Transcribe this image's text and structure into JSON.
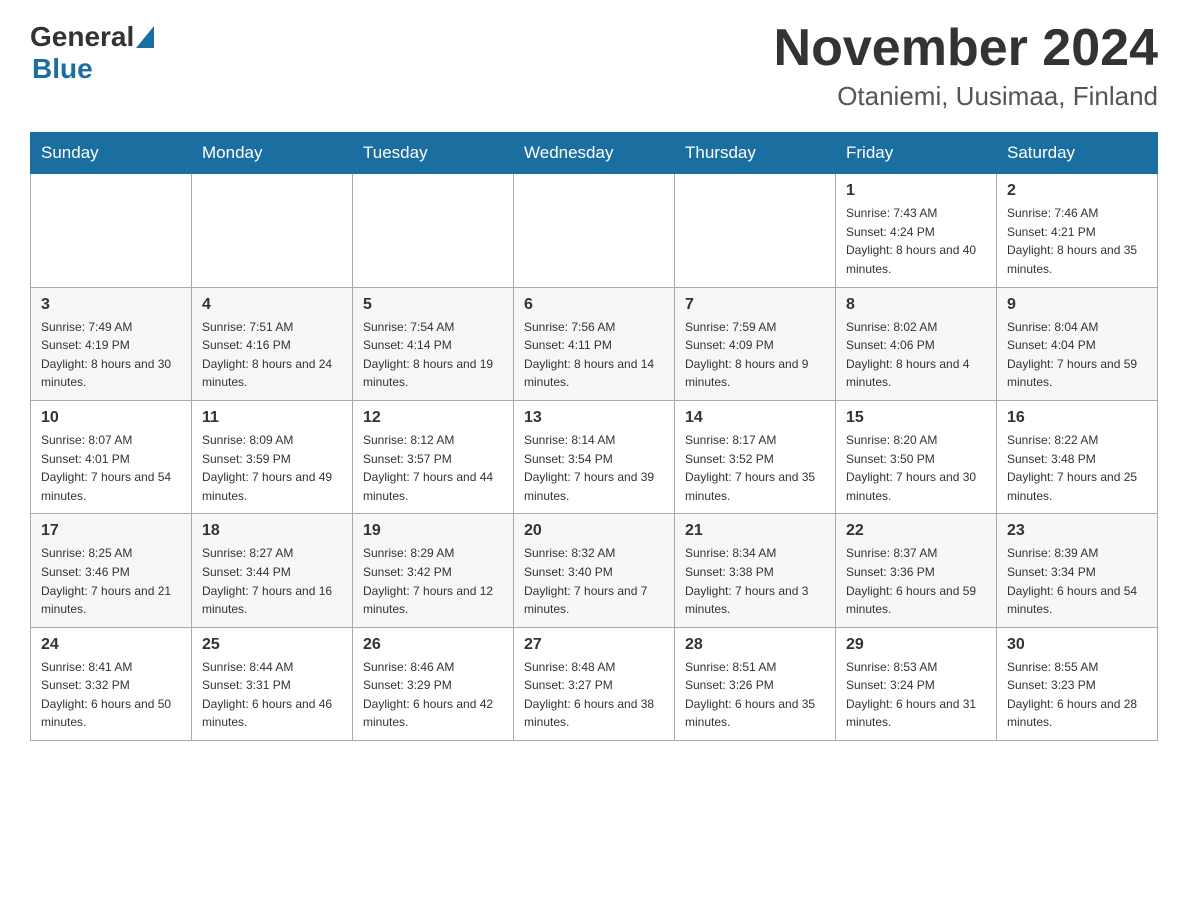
{
  "header": {
    "logo_general": "General",
    "logo_blue": "Blue",
    "month_title": "November 2024",
    "location": "Otaniemi, Uusimaa, Finland"
  },
  "days_of_week": [
    "Sunday",
    "Monday",
    "Tuesday",
    "Wednesday",
    "Thursday",
    "Friday",
    "Saturday"
  ],
  "weeks": [
    [
      {
        "day": "",
        "sunrise": "",
        "sunset": "",
        "daylight": ""
      },
      {
        "day": "",
        "sunrise": "",
        "sunset": "",
        "daylight": ""
      },
      {
        "day": "",
        "sunrise": "",
        "sunset": "",
        "daylight": ""
      },
      {
        "day": "",
        "sunrise": "",
        "sunset": "",
        "daylight": ""
      },
      {
        "day": "",
        "sunrise": "",
        "sunset": "",
        "daylight": ""
      },
      {
        "day": "1",
        "sunrise": "Sunrise: 7:43 AM",
        "sunset": "Sunset: 4:24 PM",
        "daylight": "Daylight: 8 hours and 40 minutes."
      },
      {
        "day": "2",
        "sunrise": "Sunrise: 7:46 AM",
        "sunset": "Sunset: 4:21 PM",
        "daylight": "Daylight: 8 hours and 35 minutes."
      }
    ],
    [
      {
        "day": "3",
        "sunrise": "Sunrise: 7:49 AM",
        "sunset": "Sunset: 4:19 PM",
        "daylight": "Daylight: 8 hours and 30 minutes."
      },
      {
        "day": "4",
        "sunrise": "Sunrise: 7:51 AM",
        "sunset": "Sunset: 4:16 PM",
        "daylight": "Daylight: 8 hours and 24 minutes."
      },
      {
        "day": "5",
        "sunrise": "Sunrise: 7:54 AM",
        "sunset": "Sunset: 4:14 PM",
        "daylight": "Daylight: 8 hours and 19 minutes."
      },
      {
        "day": "6",
        "sunrise": "Sunrise: 7:56 AM",
        "sunset": "Sunset: 4:11 PM",
        "daylight": "Daylight: 8 hours and 14 minutes."
      },
      {
        "day": "7",
        "sunrise": "Sunrise: 7:59 AM",
        "sunset": "Sunset: 4:09 PM",
        "daylight": "Daylight: 8 hours and 9 minutes."
      },
      {
        "day": "8",
        "sunrise": "Sunrise: 8:02 AM",
        "sunset": "Sunset: 4:06 PM",
        "daylight": "Daylight: 8 hours and 4 minutes."
      },
      {
        "day": "9",
        "sunrise": "Sunrise: 8:04 AM",
        "sunset": "Sunset: 4:04 PM",
        "daylight": "Daylight: 7 hours and 59 minutes."
      }
    ],
    [
      {
        "day": "10",
        "sunrise": "Sunrise: 8:07 AM",
        "sunset": "Sunset: 4:01 PM",
        "daylight": "Daylight: 7 hours and 54 minutes."
      },
      {
        "day": "11",
        "sunrise": "Sunrise: 8:09 AM",
        "sunset": "Sunset: 3:59 PM",
        "daylight": "Daylight: 7 hours and 49 minutes."
      },
      {
        "day": "12",
        "sunrise": "Sunrise: 8:12 AM",
        "sunset": "Sunset: 3:57 PM",
        "daylight": "Daylight: 7 hours and 44 minutes."
      },
      {
        "day": "13",
        "sunrise": "Sunrise: 8:14 AM",
        "sunset": "Sunset: 3:54 PM",
        "daylight": "Daylight: 7 hours and 39 minutes."
      },
      {
        "day": "14",
        "sunrise": "Sunrise: 8:17 AM",
        "sunset": "Sunset: 3:52 PM",
        "daylight": "Daylight: 7 hours and 35 minutes."
      },
      {
        "day": "15",
        "sunrise": "Sunrise: 8:20 AM",
        "sunset": "Sunset: 3:50 PM",
        "daylight": "Daylight: 7 hours and 30 minutes."
      },
      {
        "day": "16",
        "sunrise": "Sunrise: 8:22 AM",
        "sunset": "Sunset: 3:48 PM",
        "daylight": "Daylight: 7 hours and 25 minutes."
      }
    ],
    [
      {
        "day": "17",
        "sunrise": "Sunrise: 8:25 AM",
        "sunset": "Sunset: 3:46 PM",
        "daylight": "Daylight: 7 hours and 21 minutes."
      },
      {
        "day": "18",
        "sunrise": "Sunrise: 8:27 AM",
        "sunset": "Sunset: 3:44 PM",
        "daylight": "Daylight: 7 hours and 16 minutes."
      },
      {
        "day": "19",
        "sunrise": "Sunrise: 8:29 AM",
        "sunset": "Sunset: 3:42 PM",
        "daylight": "Daylight: 7 hours and 12 minutes."
      },
      {
        "day": "20",
        "sunrise": "Sunrise: 8:32 AM",
        "sunset": "Sunset: 3:40 PM",
        "daylight": "Daylight: 7 hours and 7 minutes."
      },
      {
        "day": "21",
        "sunrise": "Sunrise: 8:34 AM",
        "sunset": "Sunset: 3:38 PM",
        "daylight": "Daylight: 7 hours and 3 minutes."
      },
      {
        "day": "22",
        "sunrise": "Sunrise: 8:37 AM",
        "sunset": "Sunset: 3:36 PM",
        "daylight": "Daylight: 6 hours and 59 minutes."
      },
      {
        "day": "23",
        "sunrise": "Sunrise: 8:39 AM",
        "sunset": "Sunset: 3:34 PM",
        "daylight": "Daylight: 6 hours and 54 minutes."
      }
    ],
    [
      {
        "day": "24",
        "sunrise": "Sunrise: 8:41 AM",
        "sunset": "Sunset: 3:32 PM",
        "daylight": "Daylight: 6 hours and 50 minutes."
      },
      {
        "day": "25",
        "sunrise": "Sunrise: 8:44 AM",
        "sunset": "Sunset: 3:31 PM",
        "daylight": "Daylight: 6 hours and 46 minutes."
      },
      {
        "day": "26",
        "sunrise": "Sunrise: 8:46 AM",
        "sunset": "Sunset: 3:29 PM",
        "daylight": "Daylight: 6 hours and 42 minutes."
      },
      {
        "day": "27",
        "sunrise": "Sunrise: 8:48 AM",
        "sunset": "Sunset: 3:27 PM",
        "daylight": "Daylight: 6 hours and 38 minutes."
      },
      {
        "day": "28",
        "sunrise": "Sunrise: 8:51 AM",
        "sunset": "Sunset: 3:26 PM",
        "daylight": "Daylight: 6 hours and 35 minutes."
      },
      {
        "day": "29",
        "sunrise": "Sunrise: 8:53 AM",
        "sunset": "Sunset: 3:24 PM",
        "daylight": "Daylight: 6 hours and 31 minutes."
      },
      {
        "day": "30",
        "sunrise": "Sunrise: 8:55 AM",
        "sunset": "Sunset: 3:23 PM",
        "daylight": "Daylight: 6 hours and 28 minutes."
      }
    ]
  ]
}
